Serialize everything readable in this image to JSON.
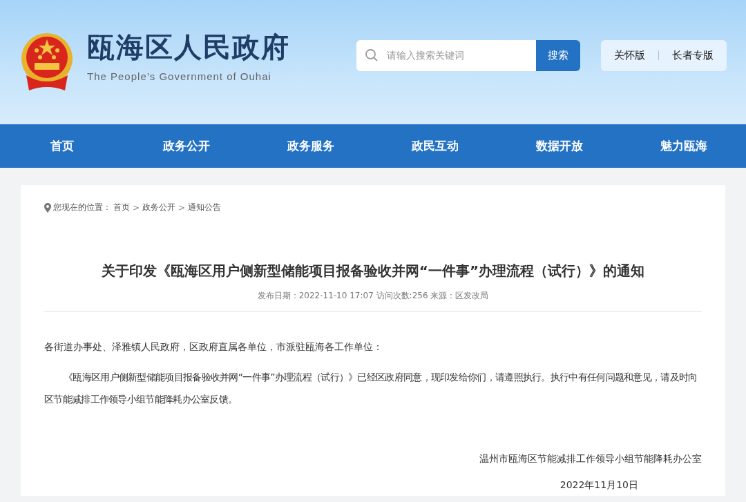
{
  "header": {
    "title": "瓯海区人民政府",
    "subtitle": "The People’s Government of Ouhai",
    "search": {
      "placeholder": "请输入搜索关键词",
      "button": "搜索"
    },
    "modes": [
      "关怀版",
      "长者专版"
    ]
  },
  "nav": [
    {
      "label": "首页"
    },
    {
      "label": "政务公开"
    },
    {
      "label": "政务服务"
    },
    {
      "label": "政民互动"
    },
    {
      "label": "数据开放"
    },
    {
      "label": "魅力瓯海"
    }
  ],
  "breadcrumb": {
    "label": "您现在的位置：",
    "items": [
      {
        "kind": "link",
        "text": "首页"
      },
      {
        "kind": "sep",
        "text": ">"
      },
      {
        "kind": "link",
        "text": "政务公开"
      },
      {
        "kind": "sep",
        "text": ">"
      },
      {
        "kind": "link",
        "text": "通知公告"
      }
    ]
  },
  "article": {
    "title": "关于印发《瓯海区用户侧新型储能项目报备验收并网“一件事”办理流程（试行）》的通知",
    "meta": "发布日期：2022-11-10 17:07 访问次数:256 来源：区发改局",
    "paragraphs": [
      {
        "kind": "salutation",
        "text": "各街道办事处、泽雅镇人民政府，区政府直属各单位，市派驻瓯海各工作单位："
      },
      {
        "kind": "body",
        "text": "《瓯海区用户侧新型储能项目报备验收并网“一件事”办理流程（试行）》已经区政府同意，现印发给你们，请遵照执行。执行中有任何问题和意见，请及时向区节能减排工作领导小组节能降耗办公室反馈。"
      }
    ],
    "signature": "温州市瓯海区节能减排工作领导小组节能降耗办公室",
    "date": "2022年11月10日"
  }
}
